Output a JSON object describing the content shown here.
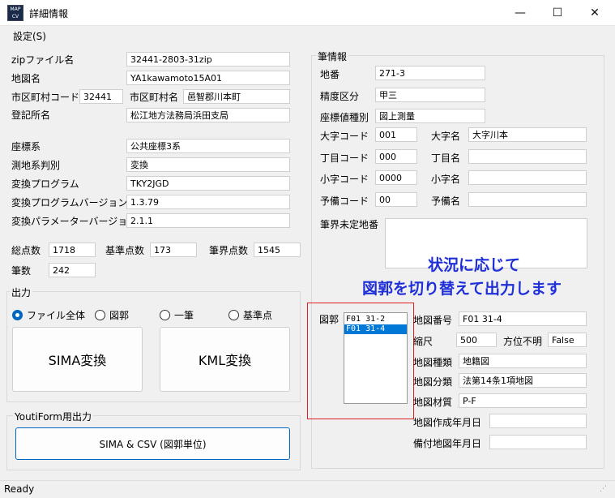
{
  "window": {
    "title": "詳細情報",
    "app_icon_text": "MAP CV",
    "minimize_glyph": "—",
    "maximize_glyph": "☐",
    "close_glyph": "✕"
  },
  "menu": {
    "settings": "設定(S)"
  },
  "left": {
    "zip_label": "zipファイル名",
    "zip_value": "32441-2803-31zip",
    "map_name_label": "地図名",
    "map_name_value": "YA1kawamoto15A01",
    "city_code_label": "市区町村コード",
    "city_code_value": "32441",
    "city_name_label": "市区町村名",
    "city_name_value": "邑智郡川本町",
    "registry_label": "登記所名",
    "registry_value": "松江地方法務局浜田支局",
    "coord_sys_label": "座標系",
    "coord_sys_value": "公共座標3系",
    "survey_label": "測地系判別",
    "survey_value": "変換",
    "conv_prog_label": "変換プログラム",
    "conv_prog_value": "TKY2JGD",
    "conv_ver_label": "変換プログラムバージョン",
    "conv_ver_value": "1.3.79",
    "conv_param_label": "変換パラメーターバージョン",
    "conv_param_value": "2.1.1",
    "total_pts_label": "総点数",
    "total_pts_value": "1718",
    "ref_pts_label": "基準点数",
    "ref_pts_value": "173",
    "boundary_pts_label": "筆界点数",
    "boundary_pts_value": "1545",
    "parcels_label": "筆数",
    "parcels_value": "242"
  },
  "output": {
    "title": "出力",
    "radios": [
      {
        "label": "ファイル全体",
        "checked": true
      },
      {
        "label": "図郭",
        "checked": false
      },
      {
        "label": "一筆",
        "checked": false
      },
      {
        "label": "基準点",
        "checked": false
      }
    ],
    "sima_button": "SIMA変換",
    "kml_button": "KML変換"
  },
  "youti": {
    "title": "YoutiForm用出力",
    "button": "SIMA & CSV (図郭単位)"
  },
  "parcel": {
    "title": "筆情報",
    "chiban_label": "地番",
    "chiban_value": "271-3",
    "accuracy_label": "精度区分",
    "accuracy_value": "甲三",
    "coord_type_label": "座標値種別",
    "coord_type_value": "図上測量",
    "oaza_code_label": "大字コード",
    "oaza_code_value": "001",
    "oaza_name_label": "大字名",
    "oaza_name_value": "大字川本",
    "chome_code_label": "丁目コード",
    "chome_code_value": "000",
    "chome_name_label": "丁目名",
    "chome_name_value": "",
    "koaza_code_label": "小字コード",
    "koaza_code_value": "0000",
    "koaza_name_label": "小字名",
    "koaza_name_value": "",
    "yobi_code_label": "予備コード",
    "yobi_code_value": "00",
    "yobi_name_label": "予備名",
    "yobi_name_value": "",
    "undetermined_label": "筆界未定地番",
    "undetermined_value": "",
    "zukaku_label": "図郭",
    "zukaku_items": [
      "F01 31-2",
      "F01 31-4"
    ],
    "map_no_label": "地図番号",
    "map_no_value": "F01 31-4",
    "scale_label": "縮尺",
    "scale_value": "500",
    "direction_label": "方位不明",
    "direction_value": "False",
    "map_type_label": "地図種類",
    "map_type_value": "地籍図",
    "map_class_label": "地図分類",
    "map_class_value": "法第14条1項地図",
    "material_label": "地図材質",
    "material_value": "P-F",
    "created_label": "地図作成年月日",
    "created_value": "",
    "attached_label": "備付地図年月日",
    "attached_value": ""
  },
  "annotation": {
    "line1": "状況に応じて",
    "line2": "図郭を切り替えて出力します"
  },
  "status": {
    "text": "Ready"
  },
  "colors": {
    "annotation": "#1f2fd8",
    "highlight_box": "#e02020",
    "selection": "#0078d7"
  }
}
